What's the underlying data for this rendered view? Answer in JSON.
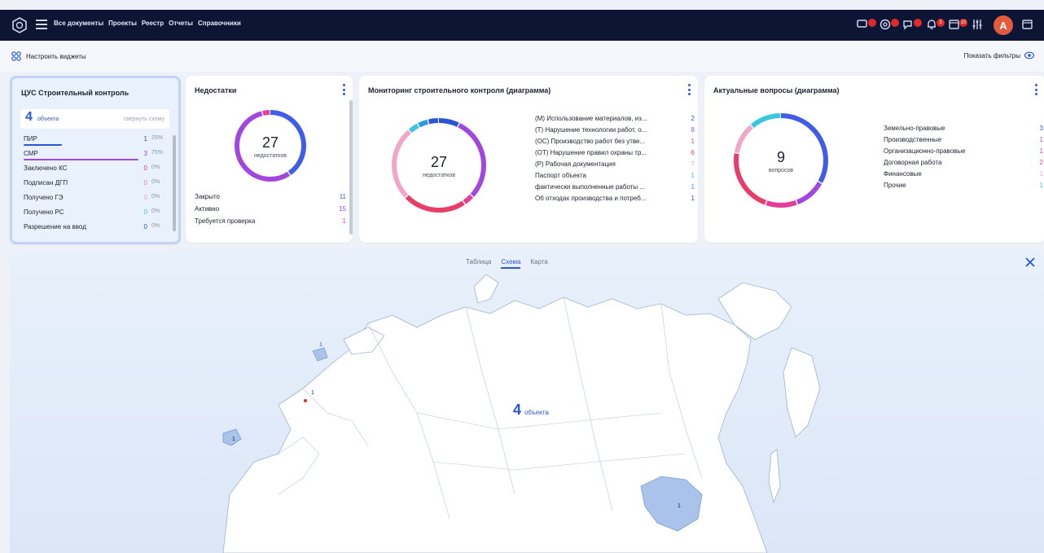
{
  "nav": {
    "items": [
      "Все документы",
      "Проекты",
      "Реестр",
      "Отчеты",
      "Справочники"
    ],
    "notif_badges": [
      "",
      "",
      "",
      "3",
      "10",
      ""
    ],
    "avatar_letter": "A"
  },
  "toolbar": {
    "widgets_label": "Настроить виджеты",
    "filters_label": "Показать фильтры"
  },
  "cus": {
    "title": "ЦУС Строительный контроль",
    "count": "4",
    "count_label": "объекта",
    "collapse_label": "свернуть схему",
    "rows": [
      {
        "label": "ПИР",
        "count": "1",
        "pct": "25%",
        "fill": 0.25,
        "color": "#2a55d8"
      },
      {
        "label": "СМР",
        "count": "3",
        "pct": "75%",
        "fill": 0.75,
        "color": "#a246e0"
      },
      {
        "label": "Заключено КС",
        "count": "0",
        "pct": "0%",
        "fill": 0,
        "color": "#e83c6a"
      },
      {
        "label": "Подписан ДГП",
        "count": "0",
        "pct": "0%",
        "fill": 0,
        "color": "#f07bb0"
      },
      {
        "label": "Получено ГЭ",
        "count": "0",
        "pct": "0%",
        "fill": 0,
        "color": "#f2a6c8"
      },
      {
        "label": "Получено РС",
        "count": "0",
        "pct": "0%",
        "fill": 0,
        "color": "#39c6e0"
      },
      {
        "label": "Разрешение на ввод",
        "count": "0",
        "pct": "0%",
        "fill": 0,
        "color": "#2a55d8"
      }
    ]
  },
  "ned": {
    "title": "Недостатки",
    "total": "27",
    "total_label": "недостатков",
    "rows": [
      {
        "label": "Закрыто",
        "value": "11",
        "color": "#3f5de6"
      },
      {
        "label": "Активно",
        "value": "15",
        "color": "#a246e0"
      },
      {
        "label": "Требуется проверка",
        "value": "1",
        "color": "#e83c9a"
      }
    ]
  },
  "mon": {
    "title": "Мониторинг строительного контроля (диаграмма)",
    "total": "27",
    "total_label": "недостатков",
    "rows": [
      {
        "label": "(М) Использование материалов, из...",
        "value": "2",
        "color": "#2a55d8"
      },
      {
        "label": "(Т) Нарушение технологии работ, о...",
        "value": "8",
        "color": "#a246e0"
      },
      {
        "label": "(ОС) Производство работ без утве...",
        "value": "1",
        "color": "#e83c9a"
      },
      {
        "label": "(ОТ) Нарушение правил охраны тр...",
        "value": "6",
        "color": "#e83c6a"
      },
      {
        "label": "(Р) Рабочая документация",
        "value": "7",
        "color": "#f2a6c8"
      },
      {
        "label": "Паспорт объекта",
        "value": "1",
        "color": "#39c6e0"
      },
      {
        "label": "фактически выполненные работы ...",
        "value": "1",
        "color": "#2a9ad8"
      },
      {
        "label": "Об отходах производства и потреб...",
        "value": "1",
        "color": "#2a55d8"
      }
    ]
  },
  "act": {
    "title": "Актуальные вопросы (диаграмма)",
    "total": "9",
    "total_label": "вопросов",
    "rows": [
      {
        "label": "Земельно-правовые",
        "value": "3",
        "color": "#3f5de6"
      },
      {
        "label": "Производственные",
        "value": "1",
        "color": "#a246e0"
      },
      {
        "label": "Организационно-правовые",
        "value": "1",
        "color": "#e83c9a"
      },
      {
        "label": "Договорная работа",
        "value": "2",
        "color": "#e83c6a"
      },
      {
        "label": "Финансовые",
        "value": "1",
        "color": "#f2a6c8"
      },
      {
        "label": "Прочие",
        "value": "1",
        "color": "#39c6e0"
      }
    ]
  },
  "map": {
    "tabs": [
      "Таблица",
      "Схема",
      "Карта"
    ],
    "active_tab": "Схема",
    "total": "4",
    "total_label": "объекта",
    "markers": [
      "1",
      "1",
      "1",
      "1"
    ]
  }
}
